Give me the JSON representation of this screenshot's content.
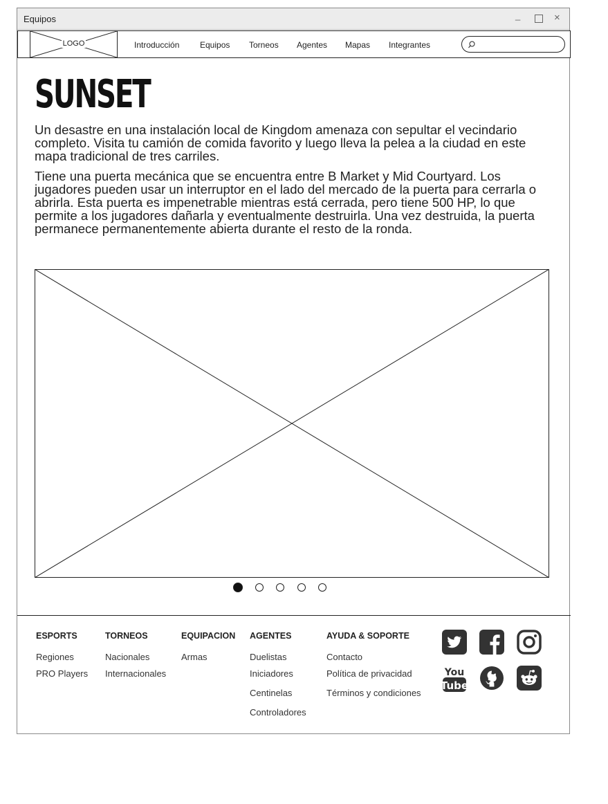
{
  "window": {
    "title": "Equipos"
  },
  "nav": {
    "logo": "LOGO",
    "items": [
      "Introducción",
      "Equipos",
      "Torneos",
      "Agentes",
      "Mapas",
      "Integrantes"
    ],
    "search_value": ""
  },
  "main": {
    "title": "SUNSET",
    "paragraphs": [
      "Un desastre en una instalación local de Kingdom amenaza con sepultar el vecindario completo. Visita tu camión de comida favorito y luego lleva la pelea a la ciudad en este mapa tradicional de tres carriles.",
      "Tiene una puerta mecánica que se encuentra entre B Market y Mid Courtyard. Los jugadores pueden usar un interruptor en el lado del mercado de la puerta para cerrarla o abrirla. Esta puerta es impenetrable mientras está cerrada, pero tiene 500 HP, lo que permite a los jugadores dañarla y eventualmente destruirla. Una vez destruida, la puerta permanece permanentemente abierta durante el resto de la ronda."
    ],
    "carousel": {
      "count": 5,
      "active": 1
    }
  },
  "footer": {
    "columns": [
      {
        "heading": "ESPORTS",
        "links": [
          "Regiones",
          "PRO Players"
        ]
      },
      {
        "heading": "TORNEOS",
        "links": [
          "Nacionales",
          "Internacionales"
        ]
      },
      {
        "heading": "EQUIPACION",
        "links": [
          "Armas"
        ]
      },
      {
        "heading": "AGENTES",
        "links": [
          "Duelistas",
          "Iniciadores",
          "Centinelas",
          "Controladores"
        ]
      },
      {
        "heading": "AYUDA & SOPORTE",
        "links": [
          "Contacto",
          "Política de privacidad",
          "Términos y condiciones"
        ]
      }
    ],
    "social": {
      "icons": [
        "twitter-icon",
        "facebook-icon",
        "instagram-icon",
        "youtube-icon",
        "github-icon",
        "reddit-icon"
      ],
      "youtube_top": "You",
      "youtube_bottom": "Tube"
    }
  }
}
